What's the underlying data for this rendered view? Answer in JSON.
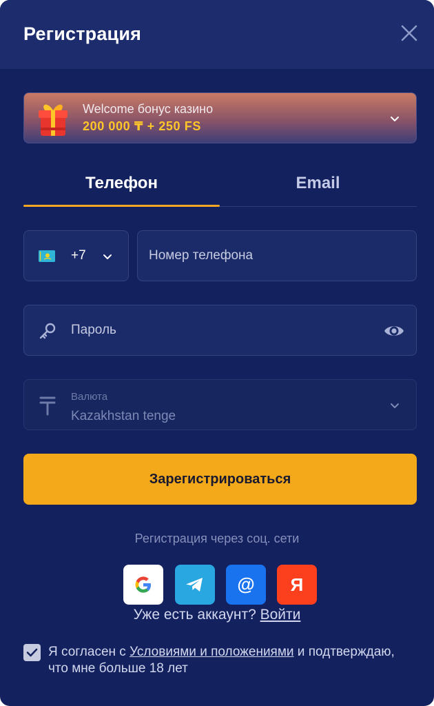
{
  "header": {
    "title": "Регистрация"
  },
  "bonus": {
    "title": "Welcome бонус казино",
    "amount": "200 000 ₸ + 250 FS"
  },
  "tabs": [
    {
      "label": "Телефон",
      "active": true
    },
    {
      "label": "Email",
      "active": false
    }
  ],
  "phone": {
    "country_code": "+7",
    "placeholder": "Номер телефона"
  },
  "password": {
    "placeholder": "Пароль"
  },
  "currency": {
    "label": "Валюта",
    "value": "Kazakhstan tenge"
  },
  "register_button": "Зарегистрироваться",
  "social": {
    "caption": "Регистрация через соц. сети",
    "providers": [
      "google",
      "telegram",
      "mail",
      "yandex"
    ],
    "yandex_letter": "Я",
    "mail_glyph": "@"
  },
  "login": {
    "prompt": "Уже есть аккаунт?",
    "link": "Войти"
  },
  "agreement": {
    "checked": true,
    "prefix": "Я согласен с ",
    "link": "Условиями и положениями",
    "suffix": " и подтверждаю, что мне больше 18 лет"
  },
  "colors": {
    "background": "#13215f",
    "header": "#1c2c6d",
    "accent": "#f4a91b",
    "bonus_amount": "#ffc629",
    "tab_indicator": "#f5a623"
  }
}
